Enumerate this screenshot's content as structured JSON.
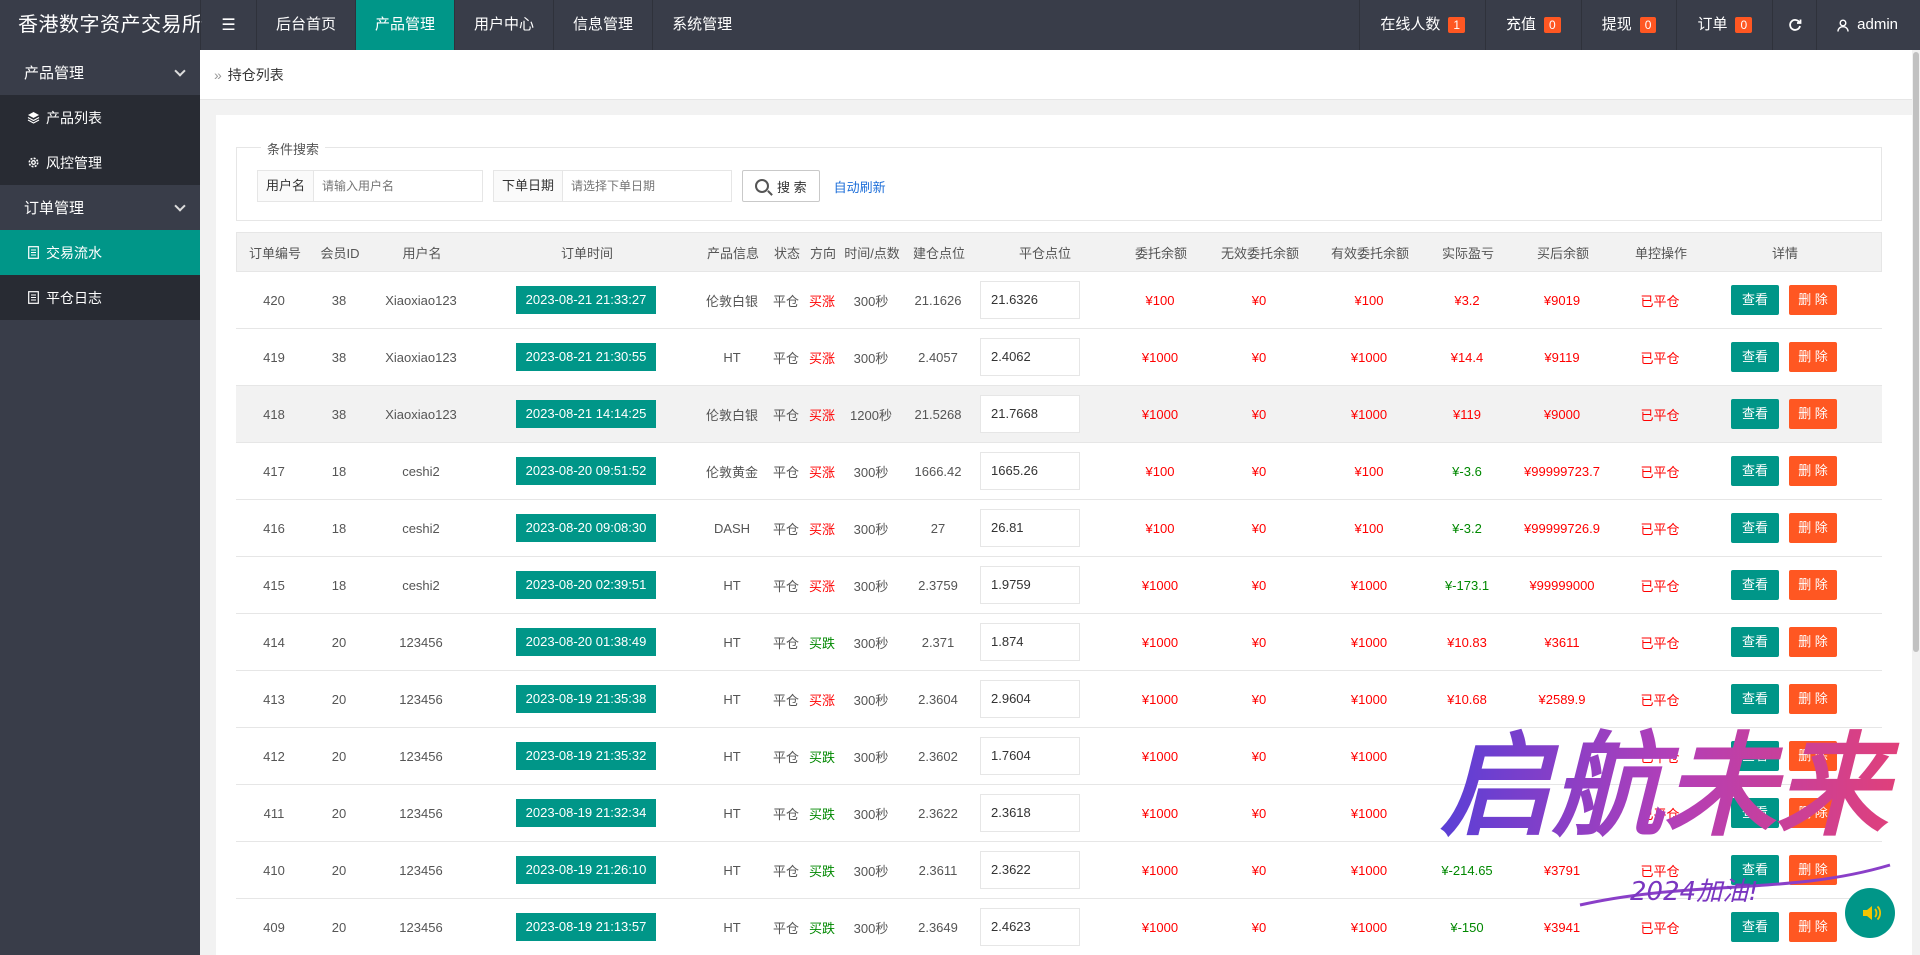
{
  "app": {
    "title": "香港数字资产交易所"
  },
  "topnav": {
    "items": [
      {
        "label": "后台首页",
        "active": false
      },
      {
        "label": "产品管理",
        "active": true
      },
      {
        "label": "用户中心",
        "active": false
      },
      {
        "label": "信息管理",
        "active": false
      },
      {
        "label": "系统管理",
        "active": false
      }
    ],
    "right": {
      "online_label": "在线人数",
      "online_count": "1",
      "recharge_label": "充值",
      "recharge_count": "0",
      "withdraw_label": "提现",
      "withdraw_count": "0",
      "order_label": "订单",
      "order_count": "0",
      "user": "admin"
    }
  },
  "sidebar": {
    "group1": "产品管理",
    "group1_items": [
      "产品列表",
      "风控管理"
    ],
    "group2": "订单管理",
    "group2_items": [
      "交易流水",
      "平仓日志"
    ]
  },
  "breadcrumb": "持仓列表",
  "search": {
    "legend": "条件搜索",
    "username_label": "用户名",
    "username_placeholder": "请输入用户名",
    "date_label": "下单日期",
    "date_placeholder": "请选择下单日期",
    "search_button": "搜 索",
    "auto_refresh": "自动刷新"
  },
  "table": {
    "headers": [
      "订单编号",
      "会员ID",
      "用户名",
      "订单时间",
      "产品信息",
      "状态",
      "方向",
      "时间/点数",
      "建仓点位",
      "平仓点位",
      "委托余额",
      "无效委托余额",
      "有效委托余额",
      "实际盈亏",
      "买后余额",
      "单控操作",
      "详情"
    ],
    "view_label": "查看",
    "delete_label": "删 除",
    "rows": [
      {
        "id": "420",
        "uid": "38",
        "name": "Xiaoxiao123",
        "time": "2023-08-21 21:33:27",
        "product": "伦敦白银",
        "status": "平仓",
        "dir": "买涨",
        "dir_color": "red",
        "dur": "300秒",
        "open": "21.1626",
        "close": "21.6326",
        "entrust": "¥100",
        "invalid": "¥0",
        "valid": "¥100",
        "pl": "¥3.2",
        "pl_color": "red",
        "after": "¥9019",
        "ctrl": "已平仓"
      },
      {
        "id": "419",
        "uid": "38",
        "name": "Xiaoxiao123",
        "time": "2023-08-21 21:30:55",
        "product": "HT",
        "status": "平仓",
        "dir": "买涨",
        "dir_color": "red",
        "dur": "300秒",
        "open": "2.4057",
        "close": "2.4062",
        "entrust": "¥1000",
        "invalid": "¥0",
        "valid": "¥1000",
        "pl": "¥14.4",
        "pl_color": "red",
        "after": "¥9119",
        "ctrl": "已平仓"
      },
      {
        "id": "418",
        "uid": "38",
        "name": "Xiaoxiao123",
        "time": "2023-08-21 14:14:25",
        "product": "伦敦白银",
        "status": "平仓",
        "dir": "买涨",
        "dir_color": "red",
        "dur": "1200秒",
        "open": "21.5268",
        "close": "21.7668",
        "entrust": "¥1000",
        "invalid": "¥0",
        "valid": "¥1000",
        "pl": "¥119",
        "pl_color": "red",
        "after": "¥9000",
        "ctrl": "已平仓"
      },
      {
        "id": "417",
        "uid": "18",
        "name": "ceshi2",
        "time": "2023-08-20 09:51:52",
        "product": "伦敦黄金",
        "status": "平仓",
        "dir": "买涨",
        "dir_color": "red",
        "dur": "300秒",
        "open": "1666.42",
        "close": "1665.26",
        "entrust": "¥100",
        "invalid": "¥0",
        "valid": "¥100",
        "pl": "¥-3.6",
        "pl_color": "green",
        "after": "¥99999723.7",
        "ctrl": "已平仓"
      },
      {
        "id": "416",
        "uid": "18",
        "name": "ceshi2",
        "time": "2023-08-20 09:08:30",
        "product": "DASH",
        "status": "平仓",
        "dir": "买涨",
        "dir_color": "red",
        "dur": "300秒",
        "open": "27",
        "close": "26.81",
        "entrust": "¥100",
        "invalid": "¥0",
        "valid": "¥100",
        "pl": "¥-3.2",
        "pl_color": "green",
        "after": "¥99999726.9",
        "ctrl": "已平仓"
      },
      {
        "id": "415",
        "uid": "18",
        "name": "ceshi2",
        "time": "2023-08-20 02:39:51",
        "product": "HT",
        "status": "平仓",
        "dir": "买涨",
        "dir_color": "red",
        "dur": "300秒",
        "open": "2.3759",
        "close": "1.9759",
        "entrust": "¥1000",
        "invalid": "¥0",
        "valid": "¥1000",
        "pl": "¥-173.1",
        "pl_color": "green",
        "after": "¥99999000",
        "ctrl": "已平仓"
      },
      {
        "id": "414",
        "uid": "20",
        "name": "123456",
        "time": "2023-08-20 01:38:49",
        "product": "HT",
        "status": "平仓",
        "dir": "买跌",
        "dir_color": "green",
        "dur": "300秒",
        "open": "2.371",
        "close": "1.874",
        "entrust": "¥1000",
        "invalid": "¥0",
        "valid": "¥1000",
        "pl": "¥10.83",
        "pl_color": "red",
        "after": "¥3611",
        "ctrl": "已平仓"
      },
      {
        "id": "413",
        "uid": "20",
        "name": "123456",
        "time": "2023-08-19 21:35:38",
        "product": "HT",
        "status": "平仓",
        "dir": "买涨",
        "dir_color": "red",
        "dur": "300秒",
        "open": "2.3604",
        "close": "2.9604",
        "entrust": "¥1000",
        "invalid": "¥0",
        "valid": "¥1000",
        "pl": "¥10.68",
        "pl_color": "red",
        "after": "¥2589.9",
        "ctrl": "已平仓"
      },
      {
        "id": "412",
        "uid": "20",
        "name": "123456",
        "time": "2023-08-19 21:35:32",
        "product": "HT",
        "status": "平仓",
        "dir": "买跌",
        "dir_color": "green",
        "dur": "300秒",
        "open": "2.3602",
        "close": "1.7604",
        "entrust": "¥1000",
        "invalid": "¥0",
        "valid": "¥1000",
        "pl": "",
        "pl_color": "red",
        "after": "",
        "ctrl": "已平仓"
      },
      {
        "id": "411",
        "uid": "20",
        "name": "123456",
        "time": "2023-08-19 21:32:34",
        "product": "HT",
        "status": "平仓",
        "dir": "买跌",
        "dir_color": "green",
        "dur": "300秒",
        "open": "2.3622",
        "close": "2.3618",
        "entrust": "¥1000",
        "invalid": "¥0",
        "valid": "¥1000",
        "pl": "",
        "pl_color": "red",
        "after": "",
        "ctrl": "已平仓"
      },
      {
        "id": "410",
        "uid": "20",
        "name": "123456",
        "time": "2023-08-19 21:26:10",
        "product": "HT",
        "status": "平仓",
        "dir": "买跌",
        "dir_color": "green",
        "dur": "300秒",
        "open": "2.3611",
        "close": "2.3622",
        "entrust": "¥1000",
        "invalid": "¥0",
        "valid": "¥1000",
        "pl": "¥-214.65",
        "pl_color": "green",
        "after": "¥3791",
        "ctrl": "已平仓"
      },
      {
        "id": "409",
        "uid": "20",
        "name": "123456",
        "time": "2023-08-19 21:13:57",
        "product": "HT",
        "status": "平仓",
        "dir": "买跌",
        "dir_color": "green",
        "dur": "300秒",
        "open": "2.3649",
        "close": "2.4623",
        "entrust": "¥1000",
        "invalid": "¥0",
        "valid": "¥1000",
        "pl": "¥-150",
        "pl_color": "green",
        "after": "¥3941",
        "ctrl": "已平仓"
      }
    ]
  },
  "watermark": {
    "text": "启航未来",
    "sub": "2024加油!"
  },
  "colors": {
    "accent": "#009688",
    "danger": "#ff5722",
    "nav": "#393d49",
    "red": "#ff0000",
    "green": "#008800"
  }
}
